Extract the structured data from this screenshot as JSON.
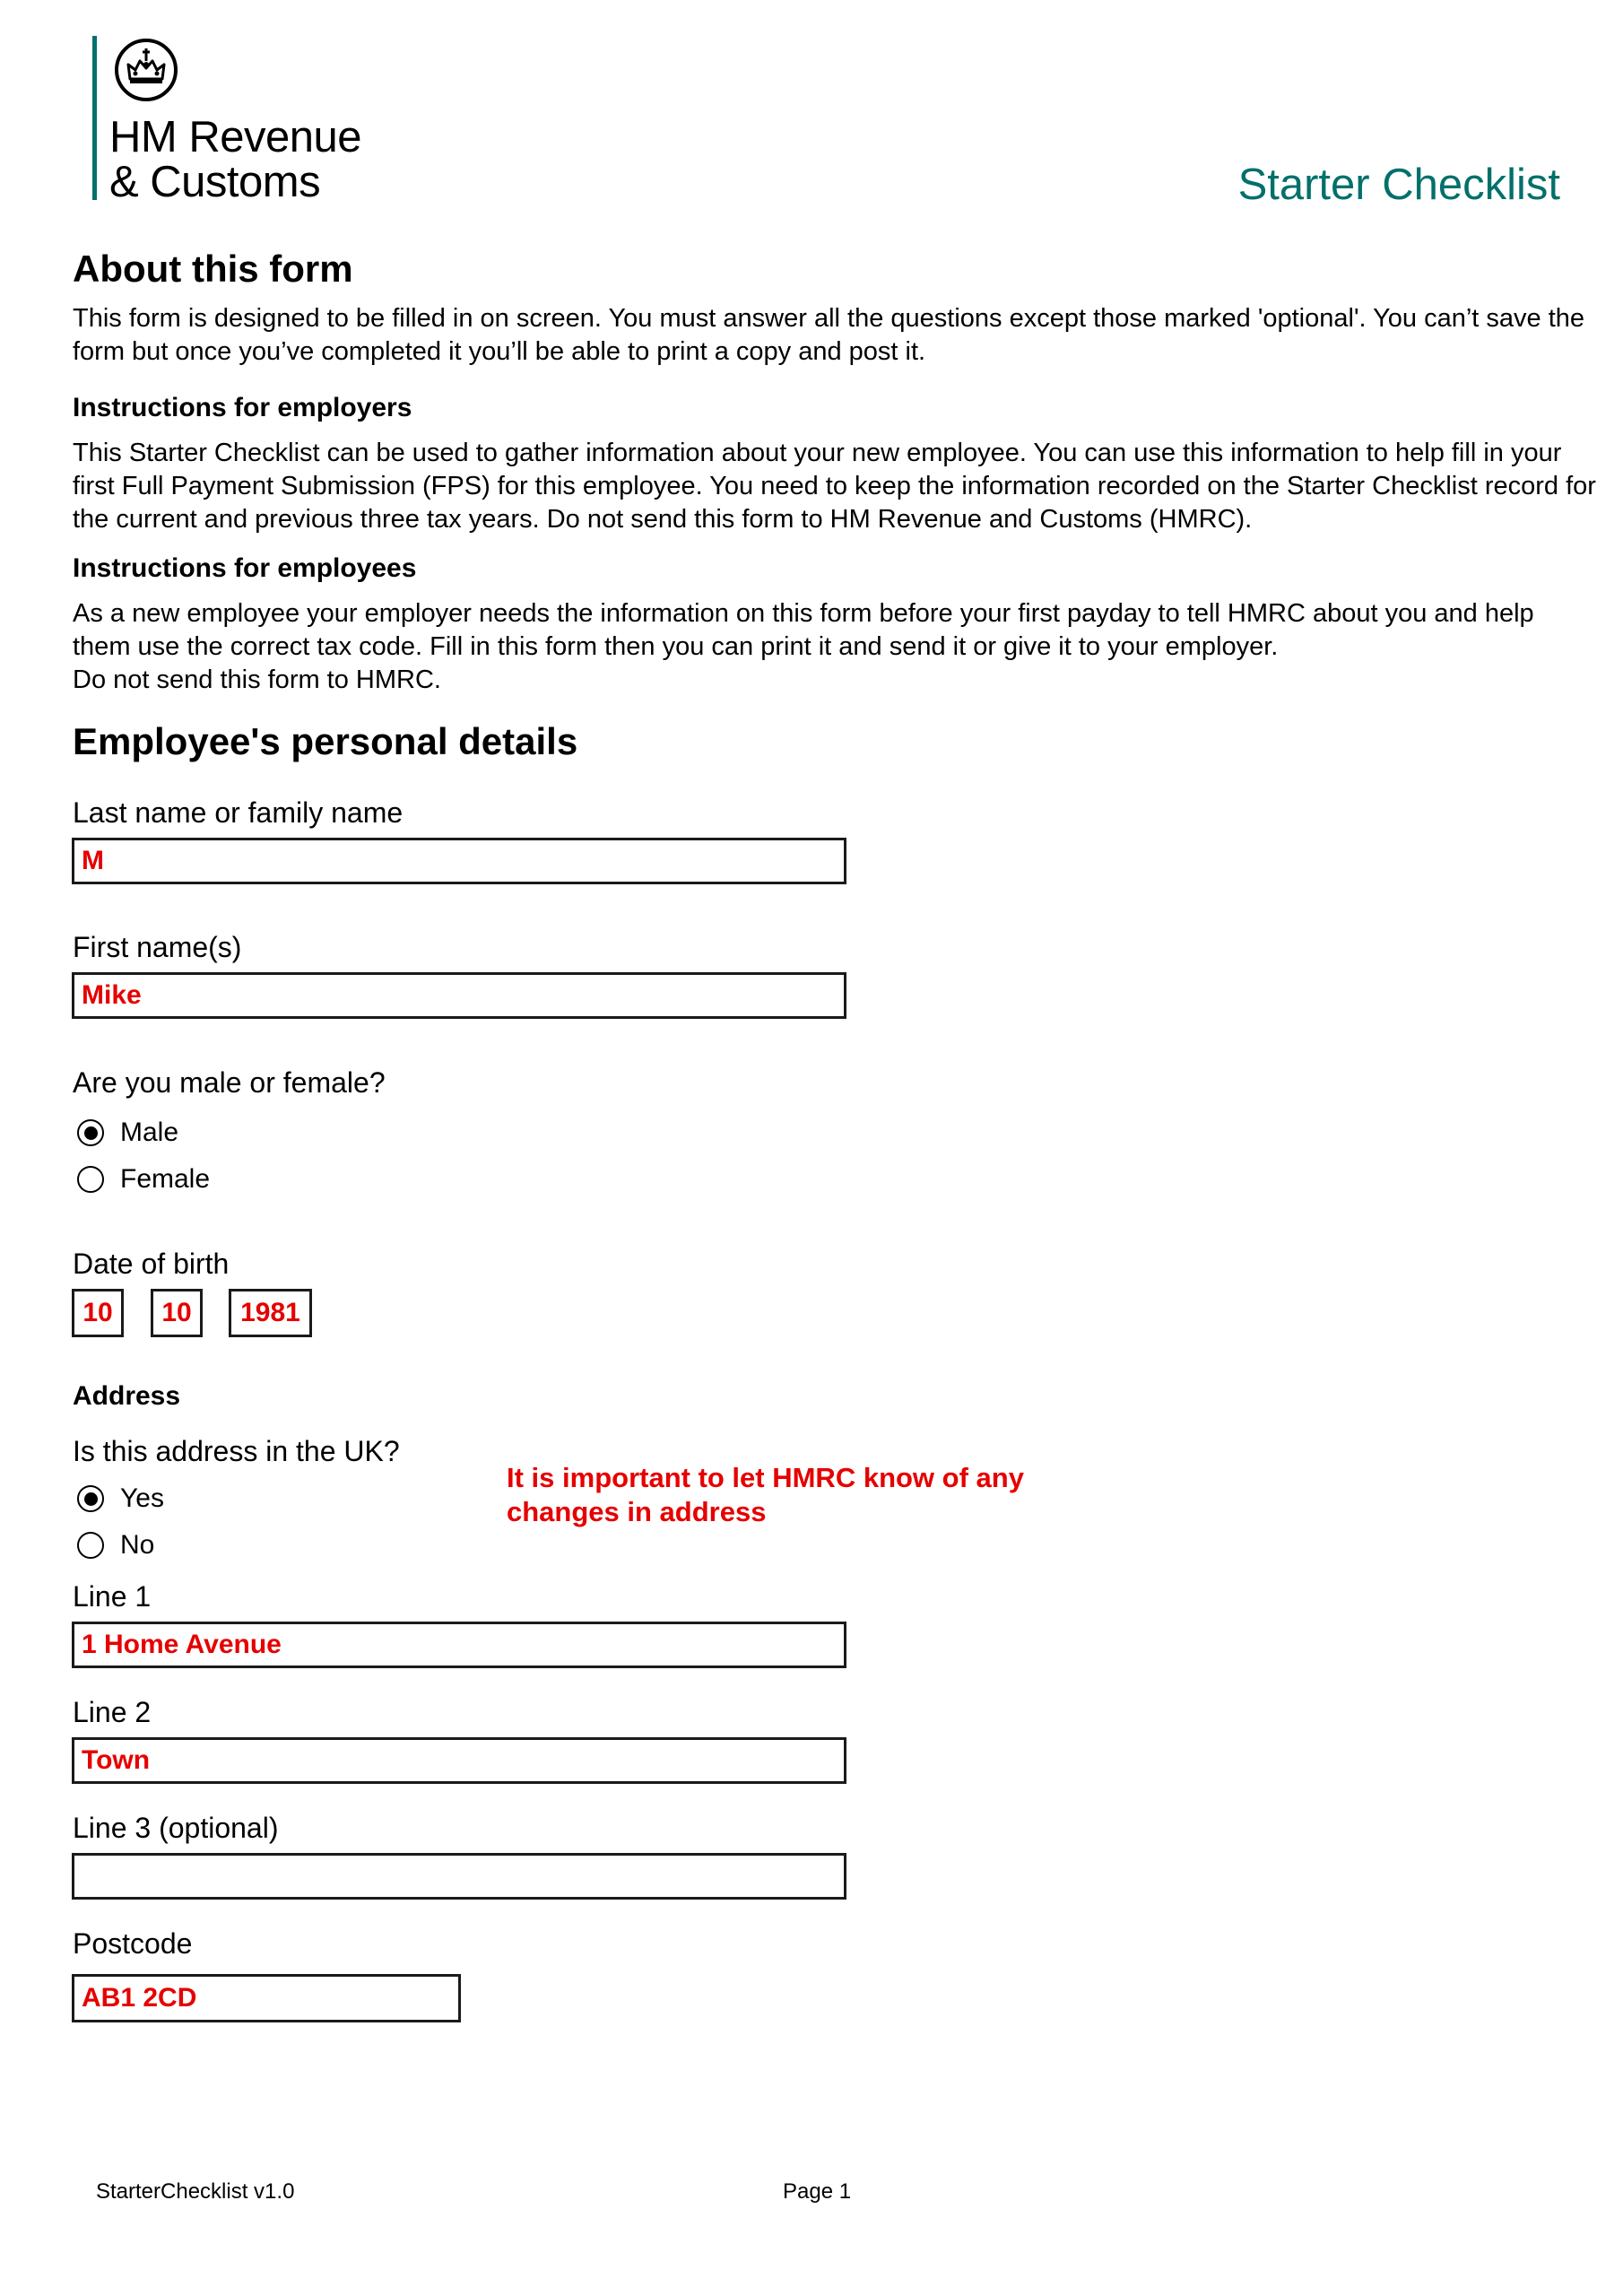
{
  "header": {
    "logo_line1": "HM Revenue",
    "logo_line2": "& Customs",
    "crest_icon": "royal-crown-crest",
    "title": "Starter Checklist",
    "brand_color": "#00706b"
  },
  "about": {
    "heading": "About this form",
    "text": "This form is designed to be filled in on screen. You must answer all the questions except those marked 'optional'. You can’t save the form but once you’ve completed it you’ll be able to print a copy and post it."
  },
  "employers": {
    "heading": "Instructions for employers",
    "text": "This Starter Checklist can be used to gather information about your new employee. You can use this information to help fill in your first Full Payment Submission (FPS) for this employee. You need to keep the information recorded on the Starter Checklist record for the current and previous three tax years. Do not send this form to HM Revenue and Customs (HMRC)."
  },
  "employees": {
    "heading": "Instructions for employees",
    "text_line1": "As a new employee your employer needs the information on this form before your first payday to tell HMRC about you and help them use the correct tax code. Fill in this form then you can print it and send it or give it to your employer.",
    "text_line2": "Do not send this form to HMRC."
  },
  "personal": {
    "heading": "Employee's personal details",
    "last_name": {
      "label": "Last name or family name",
      "value": "M"
    },
    "first_name": {
      "label": "First name(s)",
      "value": "Mike"
    },
    "gender": {
      "label": "Are you male or female?",
      "options": [
        {
          "label": "Male",
          "selected": true
        },
        {
          "label": "Female",
          "selected": false
        }
      ]
    },
    "dob": {
      "label": "Date of birth",
      "day": "10",
      "month": "10",
      "year": "1981"
    },
    "address": {
      "heading": "Address",
      "uk_question": "Is this address in the UK?",
      "uk_options": [
        {
          "label": "Yes",
          "selected": true
        },
        {
          "label": "No",
          "selected": false
        }
      ],
      "note": "It is important to let HMRC know of any changes in address",
      "line1": {
        "label": "Line 1",
        "value": "1 Home Avenue"
      },
      "line2": {
        "label": "Line 2",
        "value": "Town"
      },
      "line3": {
        "label": "Line 3 (optional)",
        "value": ""
      },
      "postcode": {
        "label": "Postcode",
        "value": "AB1 2CD"
      }
    }
  },
  "footer": {
    "version": "StarterChecklist v1.0",
    "page": "Page 1"
  },
  "colors": {
    "entered_value": "#e60000",
    "note": "#e60000"
  }
}
